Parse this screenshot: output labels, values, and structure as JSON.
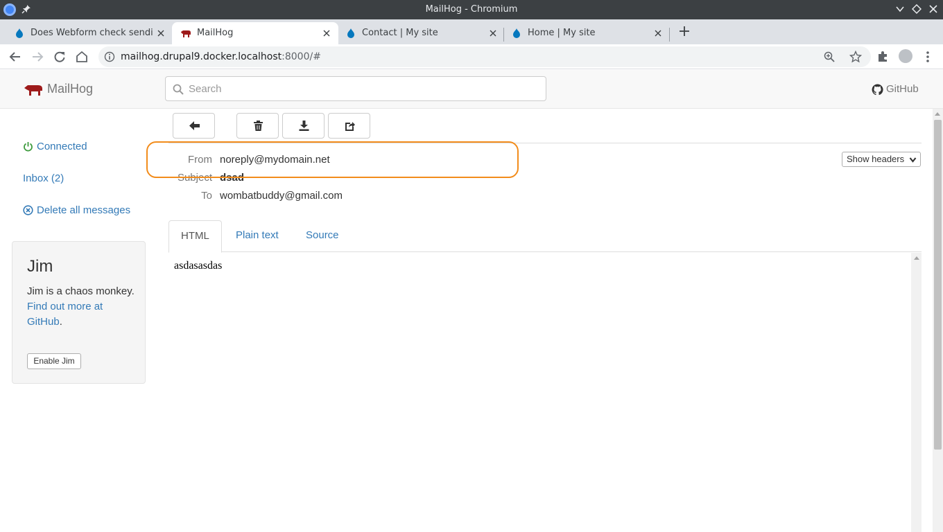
{
  "window": {
    "title": "MailHog - Chromium"
  },
  "tabs": [
    {
      "title": "Does Webform check sending",
      "icon": "drupal-icon",
      "active": false
    },
    {
      "title": "MailHog",
      "icon": "mailhog-pig-icon",
      "active": true
    },
    {
      "title": "Contact | My site",
      "icon": "drupal-icon",
      "active": false
    },
    {
      "title": "Home | My site",
      "icon": "drupal-icon",
      "active": false
    }
  ],
  "address_bar": {
    "host": "mailhog.drupal9.docker.localhost",
    "rest": ":8000/#"
  },
  "mailhog": {
    "brand": "MailHog",
    "search_placeholder": "Search",
    "github_label": "GitHub"
  },
  "sidebar": {
    "connected": "Connected",
    "inbox": "Inbox (2)",
    "delete_all": "Delete all messages",
    "jim": {
      "title": "Jim",
      "desc_prefix": "Jim is a chaos monkey.",
      "link_text": "Find out more at GitHub",
      "link_suffix": ".",
      "button": "Enable Jim"
    }
  },
  "message": {
    "from_label": "From",
    "from": "noreply@mydomain.net",
    "subject_label": "Subject",
    "subject": "dsad",
    "to_label": "To",
    "to": "wombatbuddy@gmail.com",
    "show_headers": "Show headers",
    "body_tabs": [
      "HTML",
      "Plain text",
      "Source"
    ],
    "active_body_tab": "HTML",
    "body": "asdasasdas"
  },
  "colors": {
    "link": "#337ab7",
    "highlight": "#f28c1b",
    "connected": "#3c763d",
    "brand_pig": "#9e1b1b"
  }
}
